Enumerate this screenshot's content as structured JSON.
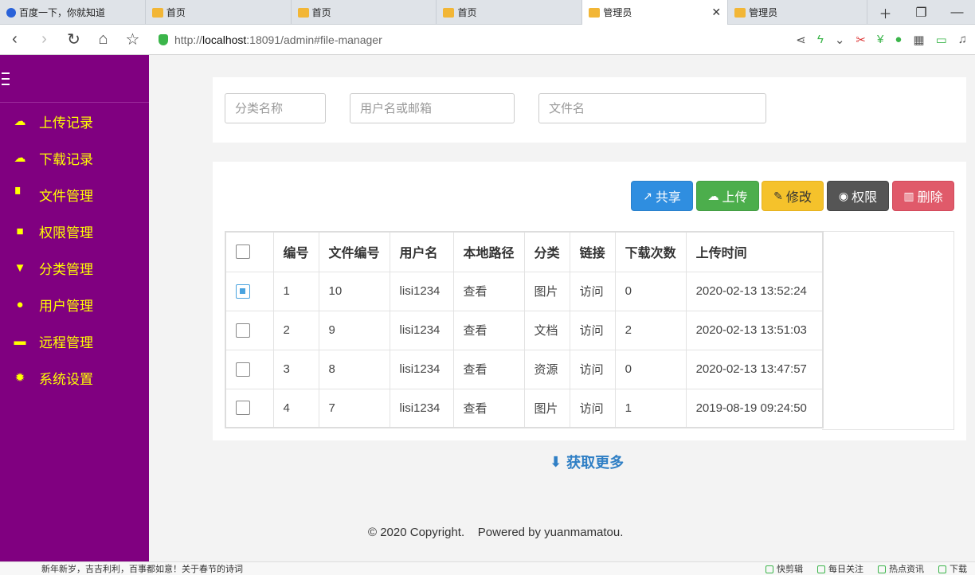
{
  "browser": {
    "tabs": [
      {
        "label": "百度一下，你就知道",
        "icon": "baidu-paw-icon",
        "active": false
      },
      {
        "label": "首页",
        "icon": "folder-icon",
        "active": false
      },
      {
        "label": "首页",
        "icon": "folder-icon",
        "active": false
      },
      {
        "label": "首页",
        "icon": "folder-icon",
        "active": false
      },
      {
        "label": "管理员",
        "icon": "folder-icon",
        "active": true
      },
      {
        "label": "管理员",
        "icon": "folder-icon",
        "active": false
      }
    ],
    "url_scheme": "http://",
    "url_host": "localhost",
    "url_rest": ":18091/admin#file-manager"
  },
  "sidebar": {
    "items": [
      {
        "label": "上传记录",
        "icon": "cloud-upload-icon"
      },
      {
        "label": "下载记录",
        "icon": "cloud-download-icon"
      },
      {
        "label": "文件管理",
        "icon": "file-icon"
      },
      {
        "label": "权限管理",
        "icon": "lock-icon"
      },
      {
        "label": "分类管理",
        "icon": "filter-icon"
      },
      {
        "label": "用户管理",
        "icon": "user-icon"
      },
      {
        "label": "远程管理",
        "icon": "folder-icon"
      },
      {
        "label": "系统设置",
        "icon": "gear-icon"
      }
    ]
  },
  "filters": {
    "category_placeholder": "分类名称",
    "user_placeholder": "用户名或邮箱",
    "filename_placeholder": "文件名"
  },
  "toolbar": {
    "share": "共享",
    "upload": "上传",
    "edit": "修改",
    "permission": "权限",
    "delete": "删除"
  },
  "table": {
    "headers": [
      "编号",
      "文件编号",
      "用户名",
      "本地路径",
      "分类",
      "链接",
      "下载次数",
      "上传时间"
    ],
    "rows": [
      {
        "checked": true,
        "id": "1",
        "file_id": "10",
        "user": "lisi1234",
        "path": "查看",
        "category": "图片",
        "link": "访问",
        "downloads": "0",
        "time": "2020-02-13 13:52:24"
      },
      {
        "checked": false,
        "id": "2",
        "file_id": "9",
        "user": "lisi1234",
        "path": "查看",
        "category": "文档",
        "link": "访问",
        "downloads": "2",
        "time": "2020-02-13 13:51:03"
      },
      {
        "checked": false,
        "id": "3",
        "file_id": "8",
        "user": "lisi1234",
        "path": "查看",
        "category": "资源",
        "link": "访问",
        "downloads": "0",
        "time": "2020-02-13 13:47:57"
      },
      {
        "checked": false,
        "id": "4",
        "file_id": "7",
        "user": "lisi1234",
        "path": "查看",
        "category": "图片",
        "link": "访问",
        "downloads": "1",
        "time": "2019-08-19 09:24:50"
      }
    ]
  },
  "load_more": "获取更多",
  "footer": {
    "copyright": "© 2020 Copyright.",
    "powered": "Powered by yuanmamatou."
  },
  "statusbar": {
    "news": "新年新岁，吉吉利利，百事都如意！关于春节的诗词",
    "clip": "快剪辑",
    "daily": "每日关注",
    "hot": "热点资讯",
    "download": "下载"
  }
}
